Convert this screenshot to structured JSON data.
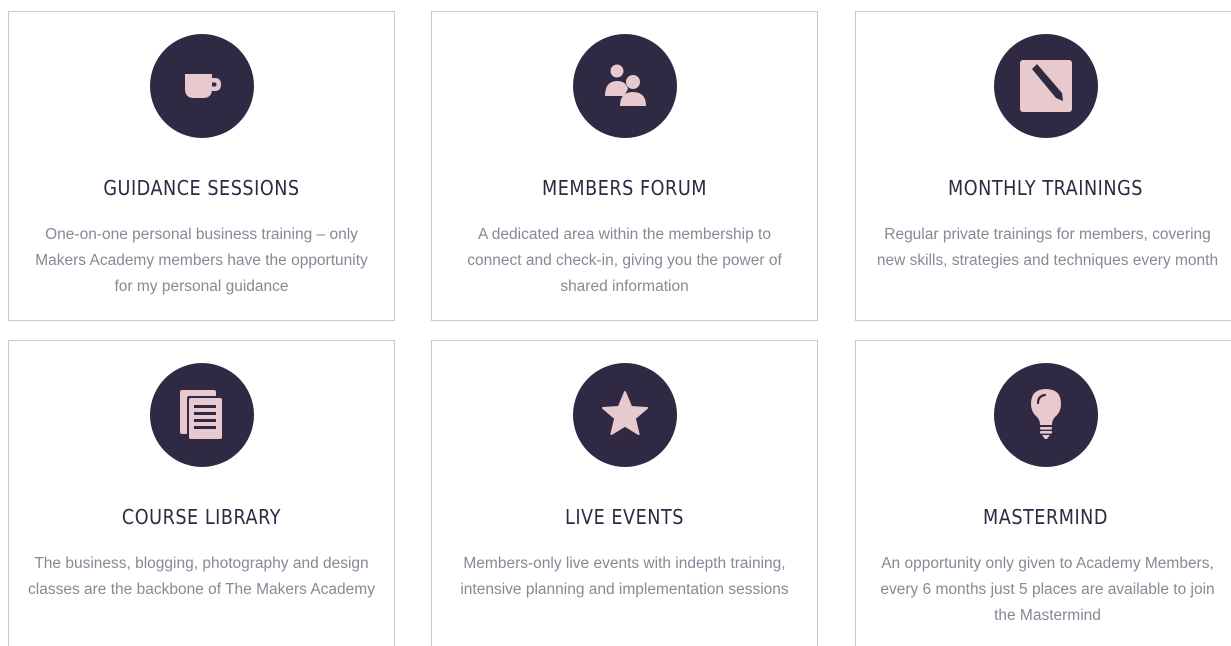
{
  "colors": {
    "icon_circle": "#2f2944",
    "icon_glyph": "#e8c9cd",
    "title": "#2f2944",
    "description": "#8a8796",
    "card_border": "#c9c9cc"
  },
  "features": [
    {
      "icon": "coffee-cup-icon",
      "title": "GUIDANCE SESSIONS",
      "description": "One-on-one personal business training – only Makers Academy members have the opportunity for my personal guidance"
    },
    {
      "icon": "people-icon",
      "title": "MEMBERS FORUM",
      "description": "A dedicated area within the membership to connect and check-in, giving you the power of shared information"
    },
    {
      "icon": "pencil-square-icon",
      "title": "MONTHLY TRAININGS",
      "description": "Regular private trainings for members, covering new skills, strategies and techniques every month"
    },
    {
      "icon": "documents-icon",
      "title": "COURSE LIBRARY",
      "description": "The business, blogging, photography and design classes are the backbone of The Makers Academy"
    },
    {
      "icon": "star-icon",
      "title": "LIVE EVENTS",
      "description": "Members-only live events with indepth training, intensive planning and implementation sessions"
    },
    {
      "icon": "lightbulb-icon",
      "title": "MASTERMIND",
      "description": "An opportunity only given to Academy Members, every 6 months just 5 places are available to join the Mastermind"
    }
  ]
}
